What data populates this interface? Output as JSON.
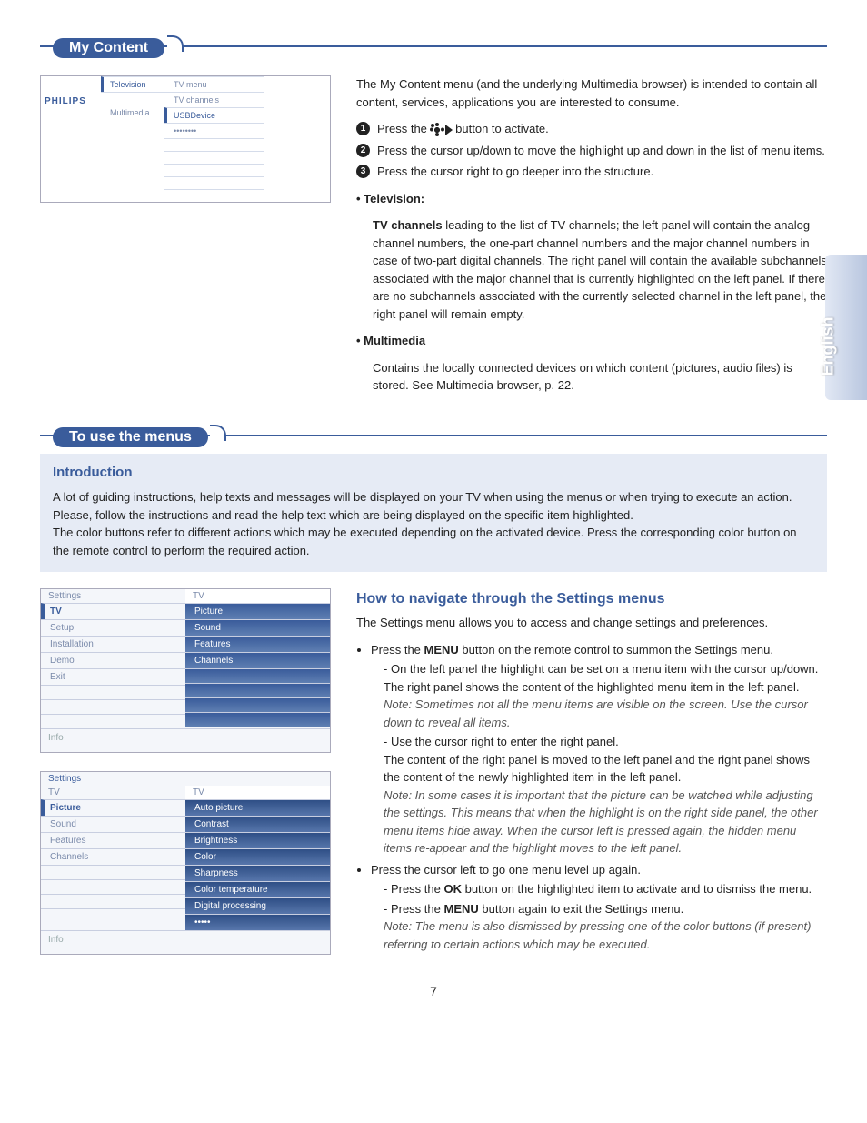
{
  "sideTab": "English",
  "sections": {
    "myContent": {
      "title": "My Content",
      "intro": "The My Content menu (and the underlying Multimedia browser) is intended to contain all content, services, applications you are interested to consume.",
      "steps": {
        "s1_a": "Press the ",
        "s1_b": " button to activate.",
        "s2": "Press the cursor up/down to move the highlight up and down in the list of menu items.",
        "s3": "Press the cursor right to go deeper into the structure."
      },
      "tv_h": "• Television:",
      "tv_body": "TV channels leading to the list of TV channels; the left panel will contain the analog channel numbers, the one-part channel numbers and the major channel numbers in case of two-part digital channels. The right panel will contain the available subchannels associated with the major channel that is currently highlighted on the left panel. If there are no subchannels associated with the currently selected channel in the left panel, the right panel will remain empty.",
      "tv_body_lead": "TV channels",
      "mm_h": "• Multimedia",
      "mm_body": "Contains the locally connected devices on which content (pictures, audio files) is stored. See Multimedia browser, p. 22.",
      "mock": {
        "brand": "PHILIPS",
        "left": {
          "a": "Television",
          "b": "Multimedia"
        },
        "mid": {
          "a": "TV menu",
          "b": "TV channels",
          "c": "USBDevice",
          "d": "••••••••"
        }
      }
    },
    "toUse": {
      "title": "To use the menus",
      "introTitle": "Introduction",
      "introBody1": "A lot of guiding instructions, help texts and messages will be displayed on your TV when using the menus or when trying to execute an action. Please, follow the instructions and read the help text which are being displayed on the specific item highlighted.",
      "introBody2": "The color buttons refer to different actions which may be executed depending on the activated device. Press the corresponding color button on the remote control to perform the required action."
    },
    "howTo": {
      "title": "How to navigate through the Settings menus",
      "lead": "The Settings menu allows you to access and change settings and preferences.",
      "b1_a": "Press the ",
      "b1_bold": "MENU",
      "b1_b": " button on the remote control to summon the Settings menu.",
      "b1s1": "On the left panel the highlight can be set on a menu item with the cursor up/down.",
      "b1s1b": "The right panel shows the content of the highlighted menu item in the left panel.",
      "b1s1n": "Note: Sometimes not all the menu items are visible on the screen. Use the cursor down to reveal all items.",
      "b1s2a": "Use the cursor right to enter the right panel.",
      "b1s2b": "The content of the right panel is moved to the left panel and the right panel shows the content of the newly highlighted item in the left panel.",
      "b1s2n": "Note: In some cases it is important that the picture can be watched while adjusting the settings. This means that when the highlight is on the right side panel, the other menu items hide away.  When the cursor left is pressed again, the hidden menu items re-appear and the highlight moves to the left panel.",
      "b2": "Press the cursor left to go one menu level up again.",
      "b2s1a": "Press the ",
      "b2s1bold": "OK",
      "b2s1b": " button on the highlighted item to activate and to dismiss the menu.",
      "b2s2a": "Press the ",
      "b2s2bold": "MENU",
      "b2s2b": " button again to exit the Settings menu.",
      "b2s2n": "Note: The menu is also dismissed by pressing one of the color buttons (if present) referring to certain actions which may be executed."
    },
    "settingsMock1": {
      "leftHeader": "Settings",
      "rightHeader": "TV",
      "left": [
        "TV",
        "Setup",
        "Installation",
        "Demo",
        "Exit"
      ],
      "right": [
        "Picture",
        "Sound",
        "Features",
        "Channels"
      ],
      "info": "Info"
    },
    "settingsMock2": {
      "topLabel": "Settings",
      "leftHeader": "TV",
      "rightHeader": "TV",
      "left": [
        "Picture",
        "Sound",
        "Features",
        "Channels"
      ],
      "right": [
        "Auto picture",
        "Contrast",
        "Brightness",
        "Color",
        "Sharpness",
        "Color temperature",
        "Digital processing",
        "•••••"
      ],
      "info": "Info"
    }
  },
  "pageNumber": "7"
}
